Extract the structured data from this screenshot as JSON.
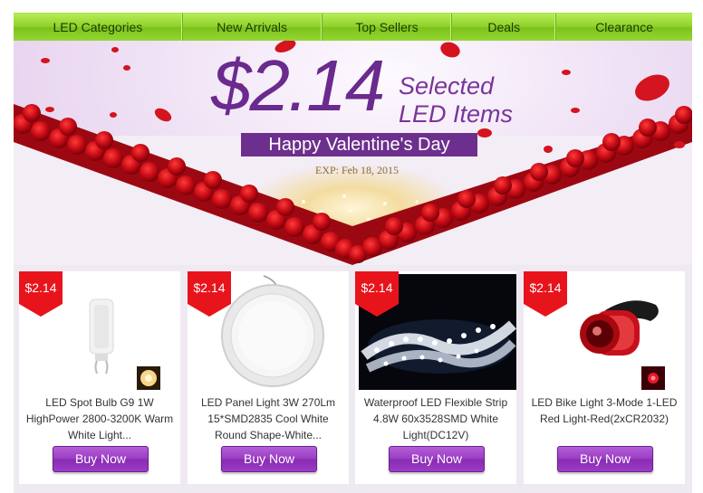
{
  "nav": {
    "items": [
      "LED Categories",
      "New Arrivals",
      "Top Sellers",
      "Deals",
      "Clearance"
    ]
  },
  "banner": {
    "price": "$2.14",
    "selected_line1": "Selected",
    "selected_line2": "LED Items",
    "ribbon": "Happy Valentine's Day",
    "exp": "EXP: Feb 18, 2015"
  },
  "products": [
    {
      "badge": "$2.14",
      "title": "LED Spot Bulb G9 1W HighPower 2800-3200K Warm White Light...",
      "button": "Buy Now"
    },
    {
      "badge": "$2.14",
      "title": "LED Panel Light 3W 270Lm 15*SMD2835 Cool White Round Shape-White...",
      "button": "Buy Now"
    },
    {
      "badge": "$2.14",
      "title": "Waterproof LED Flexible Strip 4.8W 60x3528SMD White Light(DC12V)",
      "button": "Buy Now"
    },
    {
      "badge": "$2.14",
      "title": "LED Bike Light 3-Mode 1-LED Red Light-Red(2xCR2032)",
      "button": "Buy Now"
    }
  ],
  "colors": {
    "nav_green": "#8ed12a",
    "brand_purple": "#6d2f8e",
    "badge_red": "#e8141c",
    "button_purple": "#9a3cc3"
  }
}
